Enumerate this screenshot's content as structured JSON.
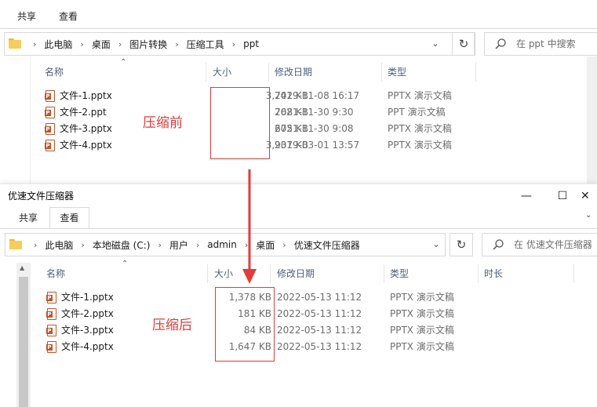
{
  "top_window": {
    "ribbon_tabs": [
      "共享",
      "查看"
    ],
    "breadcrumb": [
      "此电脑",
      "桌面",
      "图片转换",
      "压缩工具",
      "ppt"
    ],
    "search_placeholder": "在 ppt 中搜索",
    "columns": {
      "name": "名称",
      "size": "大小",
      "date": "修改日期",
      "type": "类型"
    },
    "files": [
      {
        "name": "文件-1.pptx",
        "size": "3,742 KB",
        "date": "2019-11-08 16:17",
        "type": "PPTX 演示文稿"
      },
      {
        "name": "文件-2.ppt",
        "size": "768 KB",
        "date": "2021-11-30 9:30",
        "type": "PPT 演示文稿"
      },
      {
        "name": "文件-3.pptx",
        "size": "675 KB",
        "date": "2021-11-30 9:08",
        "type": "PPTX 演示文稿"
      },
      {
        "name": "文件-4.pptx",
        "size": "3,937 KB",
        "date": "2019-03-01 13:57",
        "type": "PPTX 演示文稿"
      }
    ],
    "annotation": "压缩前"
  },
  "bottom_window": {
    "title": "优速文件压缩器",
    "ribbon_tabs": [
      "共享",
      "查看"
    ],
    "breadcrumb": [
      "此电脑",
      "本地磁盘 (C:)",
      "用户",
      "admin",
      "桌面",
      "优速文件压缩器"
    ],
    "search_placeholder": "在 优速文件压缩器",
    "columns": {
      "name": "名称",
      "size": "大小",
      "date": "修改日期",
      "type": "类型",
      "duration": "时长"
    },
    "files": [
      {
        "name": "文件-1.pptx",
        "size": "1,378 KB",
        "date": "2022-05-13 11:12",
        "type": "PPTX 演示文稿"
      },
      {
        "name": "文件-2.pptx",
        "size": "181 KB",
        "date": "2022-05-13 11:12",
        "type": "PPTX 演示文稿"
      },
      {
        "name": "文件-3.pptx",
        "size": "84 KB",
        "date": "2022-05-13 11:12",
        "type": "PPTX 演示文稿"
      },
      {
        "name": "文件-4.pptx",
        "size": "1,647 KB",
        "date": "2022-05-13 11:12",
        "type": "PPTX 演示文稿"
      }
    ],
    "annotation": "压缩后",
    "window_controls": [
      "—",
      "☐"
    ]
  },
  "icons": {
    "file": "powerpoint-file-icon",
    "folder": "folder-icon",
    "search": "search-icon",
    "refresh": "refresh-icon",
    "arrow": "red-down-arrow"
  },
  "colors": {
    "annotation_red": "#e03c3c",
    "header_text": "#4c607a",
    "folder_yellow": "#f5cd5c",
    "ppt_orange": "#c4532a"
  }
}
